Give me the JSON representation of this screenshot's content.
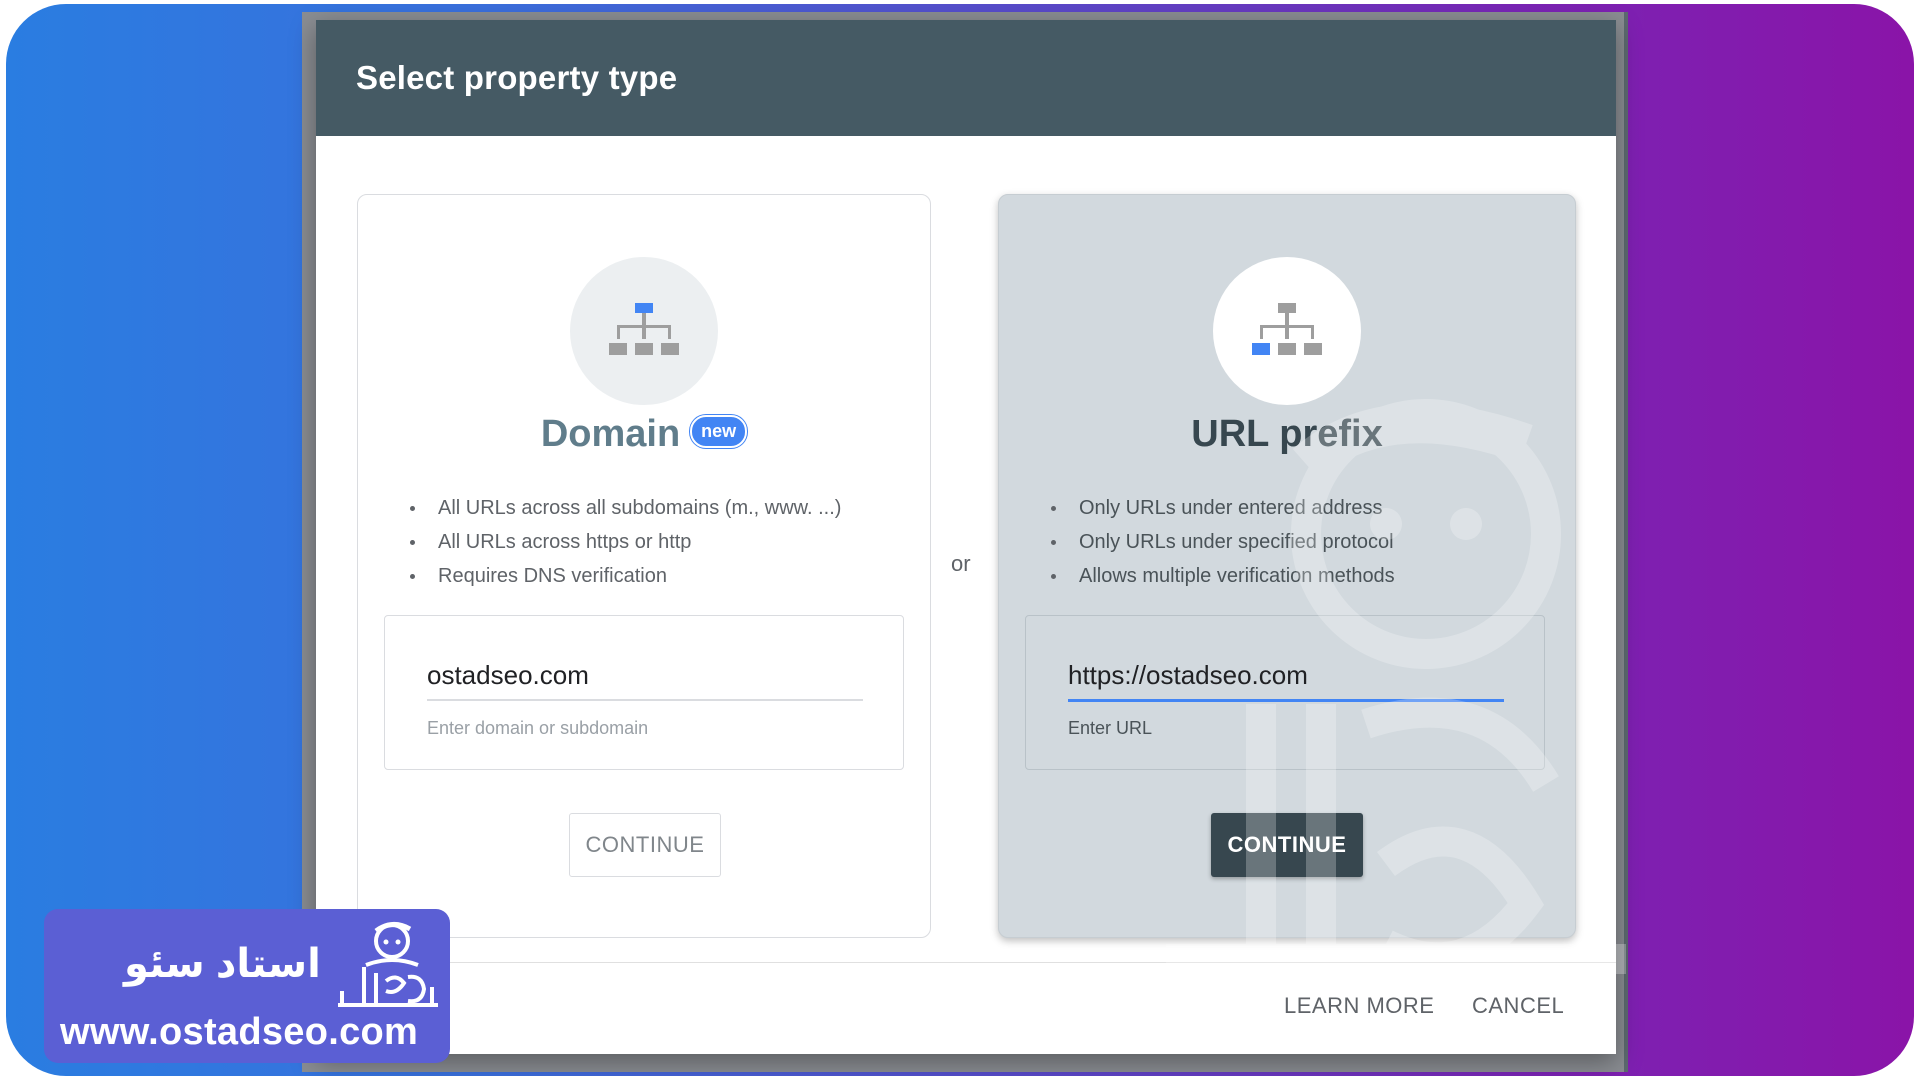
{
  "dialog": {
    "title": "Select property type",
    "separator": "or",
    "footer": {
      "learn_more": "LEARN MORE",
      "cancel": "CANCEL"
    }
  },
  "domain_card": {
    "title": "Domain",
    "badge": "new",
    "icon": "sitemap-icon",
    "bullets": [
      "All URLs across all subdomains (m., www. ...)",
      "All URLs across https or http",
      "Requires DNS verification"
    ],
    "input_value": "ostadseo.com",
    "input_hint": "Enter domain or subdomain",
    "button": "CONTINUE",
    "button_state": "disabled"
  },
  "url_prefix_card": {
    "title": "URL prefix",
    "icon": "sitemap-icon",
    "selected": true,
    "bullets": [
      "Only URLs under entered address",
      "Only URLs under specified protocol",
      "Allows multiple verification methods"
    ],
    "input_value": "https://ostadseo.com",
    "input_hint": "Enter URL",
    "button": "CONTINUE",
    "button_state": "enabled"
  },
  "brand": {
    "name": "استاد سئو",
    "url": "www.ostadseo.com"
  },
  "colors": {
    "header": "#455a64",
    "accent": "#4285f4",
    "primary_button": "#37474f",
    "selected_card": "#d2d9de",
    "frame_gradient_start": "#2a7de1",
    "frame_gradient_end": "#8a14a8"
  }
}
